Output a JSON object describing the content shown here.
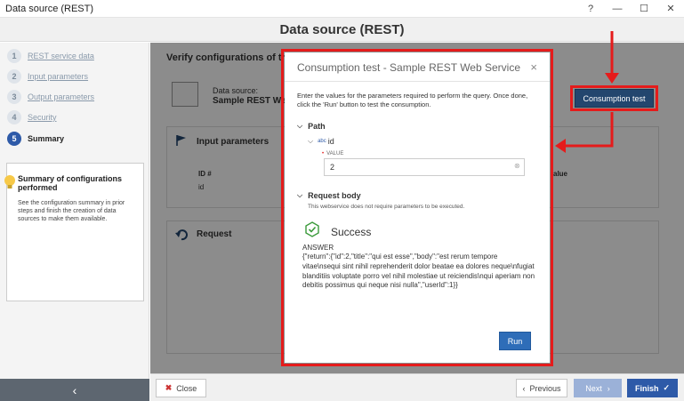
{
  "window": {
    "title": "Data source (REST)",
    "controls": [
      "?",
      "—",
      "☐",
      "✕"
    ]
  },
  "header": {
    "title": "Data source (REST)"
  },
  "sidebar": {
    "steps": [
      {
        "number": "1",
        "label": "REST service data"
      },
      {
        "number": "2",
        "label": "Input parameters"
      },
      {
        "number": "3",
        "label": "Output parameters"
      },
      {
        "number": "4",
        "label": "Security"
      },
      {
        "number": "5",
        "label": "Summary"
      }
    ],
    "info": {
      "title": "Summary of configurations performed",
      "text": "See the configuration summary in prior steps and finish the creation of data sources to make them available."
    },
    "collapse_icon": "‹"
  },
  "main": {
    "title": "Verify configurations of this da",
    "data_source_label": "Data source:",
    "data_source_name": "Sample REST Web",
    "input_parameters_title": "Input parameters",
    "col_id": "ID #",
    "col_value": "alue",
    "row_id": "id",
    "request_title": "Request"
  },
  "consumption_test_button": "Consumption test",
  "modal": {
    "title": "Consumption test - Sample REST Web Service",
    "close": "×",
    "description": "Enter the values for the parameters required to perform the query. Once done, click the 'Run' button to test the consumption.",
    "path_label": "Path",
    "param_name": "id",
    "param_type": "abc",
    "value_label": "VALUE",
    "value": "2",
    "request_body_label": "Request body",
    "request_body_note": "This webservice does not require parameters to be executed.",
    "success_label": "Success",
    "answer_label": "ANSWER",
    "answer_text": "{\"return\":{\"id\":2,\"title\":\"qui est esse\",\"body\":\"est rerum tempore vitae\\nsequi sint nihil reprehenderit dolor beatae ea dolores neque\\nfugiat blanditiis voluptate porro vel nihil molestiae ut reiciendis\\nqui aperiam non debitis possimus qui neque nisi nulla\",\"userId\":1}}",
    "run_label": "Run"
  },
  "footer": {
    "close_label": "Close",
    "previous_label": "Previous",
    "next_label": "Next",
    "finish_label": "Finish"
  },
  "colors": {
    "accent": "#2e5aa8",
    "annotation": "#e51b1b",
    "dark_button": "#23466e",
    "success": "#3a9a3a"
  }
}
